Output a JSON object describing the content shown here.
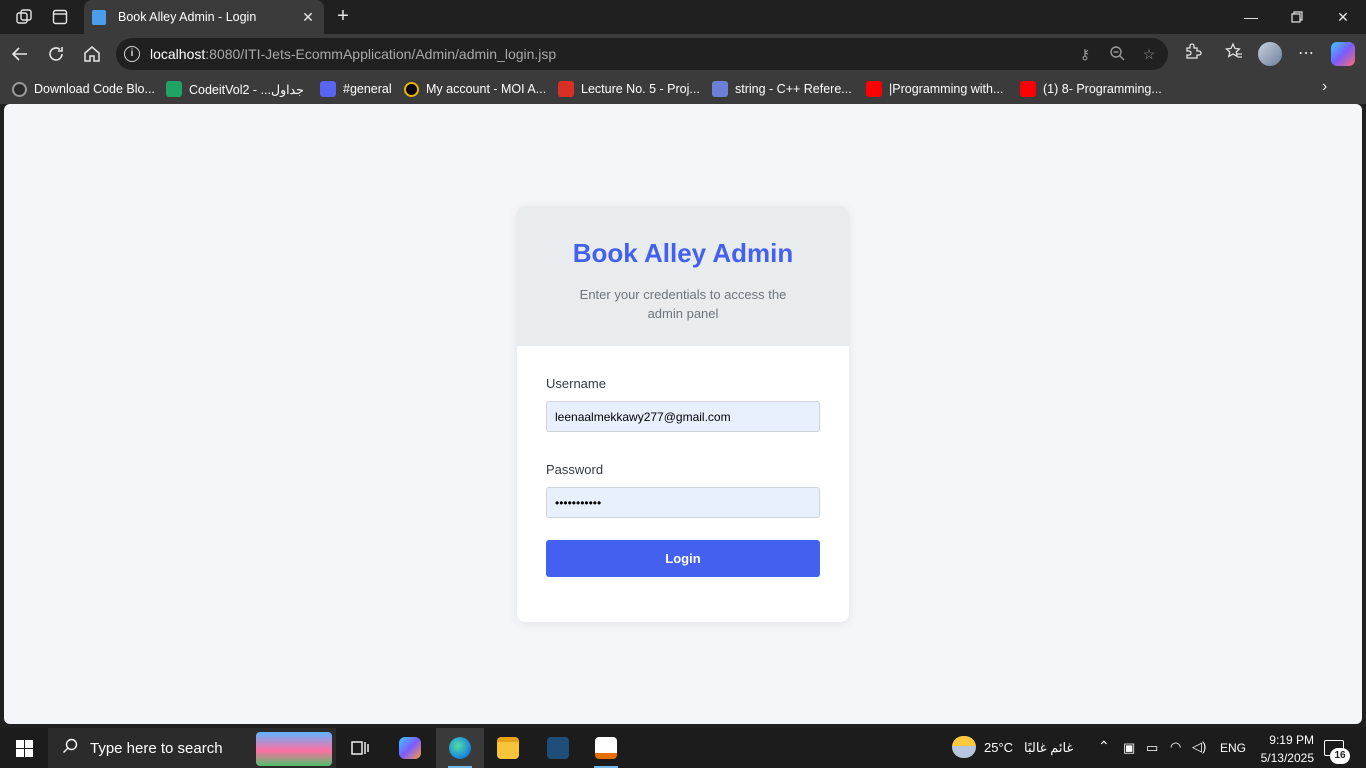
{
  "browser": {
    "tab": {
      "title": "Book Alley Admin - Login"
    },
    "address": {
      "host": "localhost",
      "path": ":8080/ITI-Jets-EcommApplication/Admin/admin_login.jsp"
    },
    "bookmarks": [
      {
        "label": "Download Code Blo...",
        "color": "#2b2b2b"
      },
      {
        "label": "CodeitVol2 - ...جداول",
        "color": "#21a366"
      },
      {
        "label": "#general",
        "color": "#5865f2"
      },
      {
        "label": "My account - MOI A...",
        "color": "#e8b400"
      },
      {
        "label": "Lecture No. 5 - Proj...",
        "color": "#d93025"
      },
      {
        "label": "string - C++ Refere...",
        "color": "#6b7fd7"
      },
      {
        "label": "|Programming with...",
        "color": "#ff0000"
      },
      {
        "label": "(1) 8- Programming...",
        "color": "#ff0000"
      }
    ]
  },
  "login": {
    "title": "Book Alley Admin",
    "subtitle": "Enter your credentials to access the admin panel",
    "username_label": "Username",
    "username_value": "leenaalmekkawy277@gmail.com",
    "password_label": "Password",
    "password_value": "•••••••••••",
    "submit_label": "Login"
  },
  "taskbar": {
    "search_placeholder": "Type here to search",
    "weather": "25°C",
    "weather_desc": "غائم غالبًا",
    "language": "ENG",
    "time": "9:19 PM",
    "date": "5/13/2025",
    "notifications": "16"
  },
  "colors": {
    "accent": "#4361ee",
    "card_header": "#e9ecef",
    "page_bg": "#f4f6fa"
  }
}
